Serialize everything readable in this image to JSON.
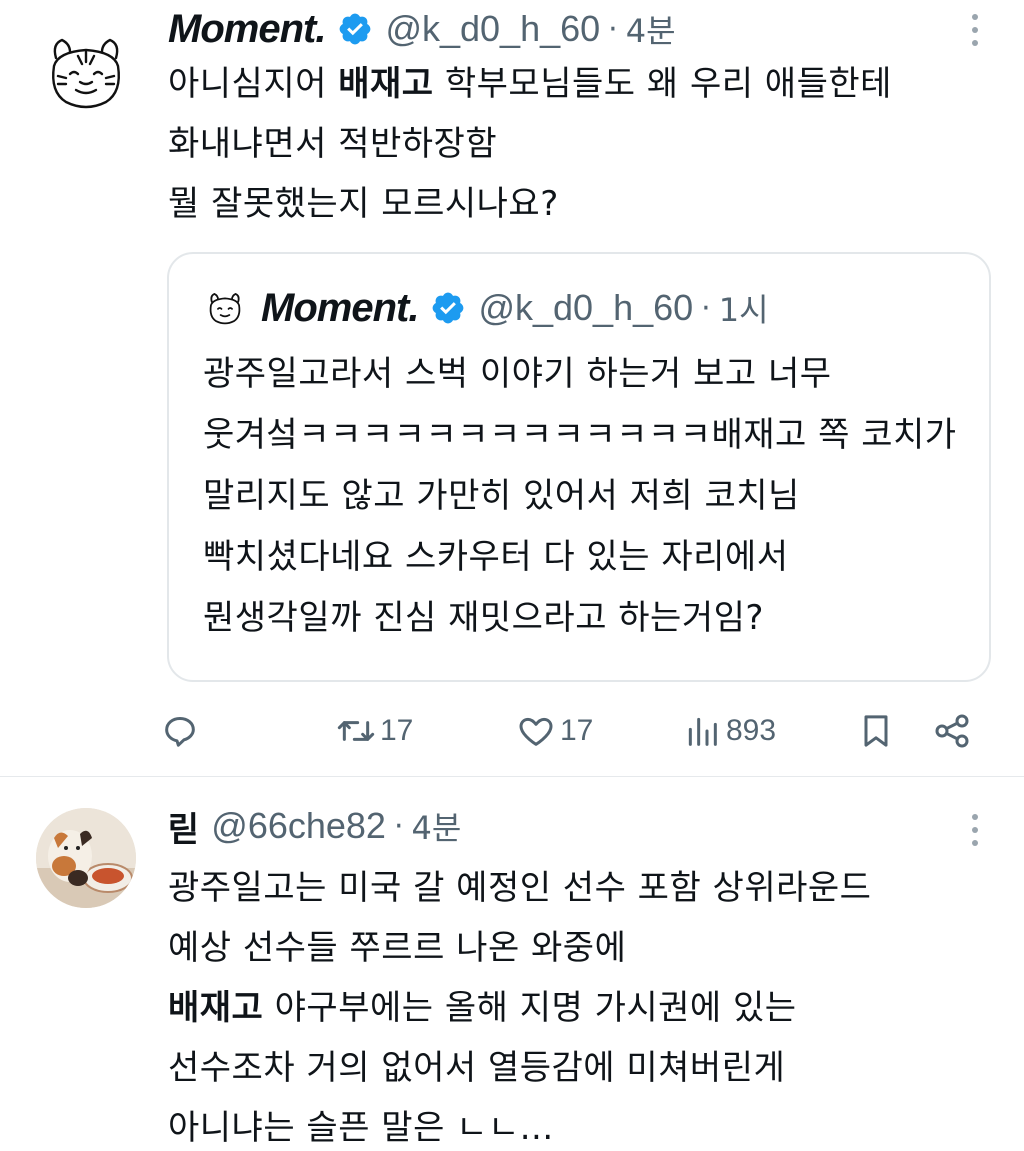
{
  "tweets": [
    {
      "author": "Moment.",
      "handle": "@k_d0_h_60",
      "separator": "·",
      "time": "4분",
      "verified": true,
      "avatar_icon": "tiger-doodle-avatar",
      "lines": [
        {
          "pre": "아니심지어 ",
          "bold": "배재고",
          "post": " 학부모님들도 왜 우리 애들한테"
        },
        {
          "pre": "화내냐면서 적반하장함",
          "bold": "",
          "post": ""
        },
        {
          "pre": "뭘 잘못했는지 모르시나요?",
          "bold": "",
          "post": ""
        }
      ],
      "quote": {
        "author": "Moment.",
        "handle": "@k_d0_h_60",
        "separator": "·",
        "time": "1시",
        "lines": [
          "광주일고라서 스벅 이야기 하는거 보고 너무",
          "웃겨섴ㅋㅋㅋㅋㅋㅋㅋㅋㅋㅋㅋㅋㅋ배재고 쪽 코치가",
          "말리지도 않고 가만히 있어서 저희 코치님",
          "빡치셨다네요 스카우터 다 있는 자리에서",
          "뭔생각일까 진심 재밋으라고 하는거임?"
        ]
      },
      "actions": {
        "reply_count": "",
        "retweet_count": "17",
        "like_count": "17",
        "views_count": "893"
      }
    },
    {
      "author": "릳",
      "handle": "@66che82",
      "separator": "·",
      "time": "4분",
      "avatar_icon": "cat-photo-avatar",
      "lines": [
        {
          "pre": "광주일고는 미국 갈 예정인 선수 포함 상위라운드",
          "bold": "",
          "post": ""
        },
        {
          "pre": "예상 선수들 쭈르르 나온 와중에",
          "bold": "",
          "post": ""
        },
        {
          "pre": "",
          "bold": "배재고",
          "post": " 야구부에는 올해 지명 가시권에 있는"
        },
        {
          "pre": "선수조차 거의 없어서 열등감에 미쳐버린게",
          "bold": "",
          "post": ""
        },
        {
          "pre": "아니냐는  슬픈 말은 ㄴㄴ...",
          "bold": "",
          "post": ""
        }
      ]
    }
  ],
  "colors": {
    "verified_blue": "#1d9bf0",
    "secondary_text": "#536471",
    "divider": "#e6e9ec"
  }
}
